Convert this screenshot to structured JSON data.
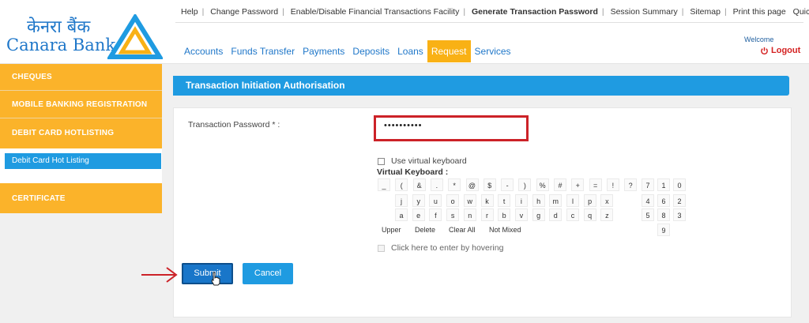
{
  "header": {
    "logo_hindi": "केनरा बैंक",
    "logo_text": "Canara Bank",
    "top_links": [
      "Help",
      "Change Password",
      "Enable/Disable Financial Transactions Facility",
      "Generate Transaction Password",
      "Session Summary",
      "Sitemap",
      "Print this page"
    ],
    "quick_links": "Quick Links >",
    "welcome": "Welcome",
    "logout": "Logout"
  },
  "nav": {
    "items": [
      "Accounts",
      "Funds Transfer",
      "Payments",
      "Deposits",
      "Loans",
      "Request",
      "Services"
    ],
    "active": "Request"
  },
  "sidebar": {
    "items": [
      "CHEQUES",
      "MOBILE BANKING REGISTRATION",
      "DEBIT CARD HOTLISTING",
      "CERTIFICATE"
    ],
    "sub_item": "Debit Card Hot Listing"
  },
  "panel": {
    "title": "Transaction Initiation Authorisation",
    "password_label": "Transaction Password * :",
    "password_value": "••••••••••",
    "virtual_keyboard_checkbox": "Use virtual keyboard",
    "virtual_keyboard_title": "Virtual Keyboard :",
    "keys_row1": [
      "_",
      "(",
      "&",
      ".",
      "*",
      "@",
      "$",
      "-",
      ")",
      "%",
      "#",
      "+",
      "=",
      "!",
      "?"
    ],
    "keys_row2": [
      "j",
      "y",
      "u",
      "o",
      "w",
      "k",
      "t",
      "i",
      "h",
      "m",
      "l",
      "p",
      "x"
    ],
    "keys_row3": [
      "a",
      "e",
      "f",
      "s",
      "n",
      "r",
      "b",
      "v",
      "g",
      "d",
      "c",
      "q",
      "z"
    ],
    "numpad": [
      "7",
      "1",
      "0",
      "4",
      "6",
      "2",
      "5",
      "8",
      "3",
      "9"
    ],
    "vk_buttons": [
      "Upper",
      "Delete",
      "Clear All",
      "Not Mixed"
    ],
    "hover_checkbox": "Click here to enter by hovering",
    "submit_label": "Submit",
    "cancel_label": "Cancel"
  },
  "colors": {
    "brand_blue": "#1f77c9",
    "accent_orange": "#fbb32a",
    "panel_blue": "#1f9be1",
    "highlight_red": "#cc2228"
  }
}
